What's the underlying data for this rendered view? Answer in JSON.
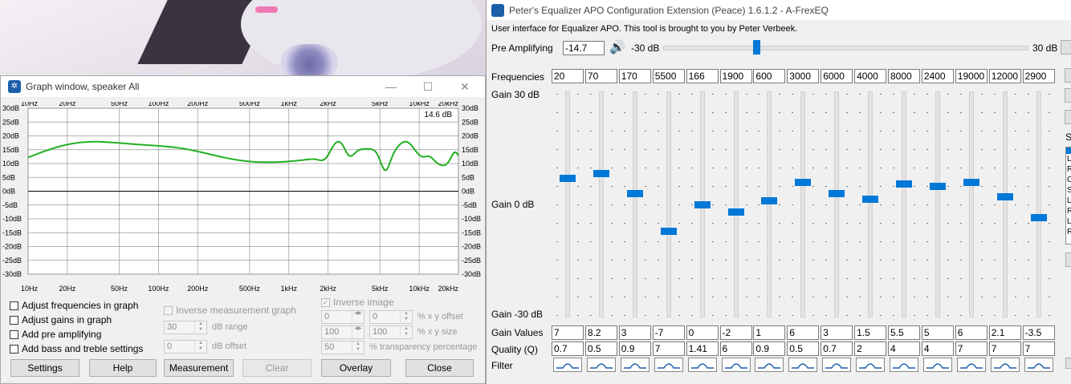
{
  "graph_window": {
    "title": "Graph window, speaker All",
    "readout": "14.6 dB",
    "freq_labels": [
      "10Hz",
      "20Hz",
      "50Hz",
      "100Hz",
      "200Hz",
      "500Hz",
      "1kHz",
      "2kHz",
      "5kHz",
      "10kHz",
      "20kHz"
    ],
    "db_labels": [
      "30dB",
      "25dB",
      "20dB",
      "15dB",
      "10dB",
      "5dB",
      "0dB",
      "-5dB",
      "-10dB",
      "-15dB",
      "-20dB",
      "-25dB",
      "-30dB"
    ],
    "curve_color": "#22b022",
    "checkboxes": {
      "adjust_freq": "Adjust frequencies in graph",
      "adjust_gains": "Adjust gains in graph",
      "add_pre": "Add pre amplifying",
      "add_bass": "Add bass and treble settings",
      "inverse_measurement": "Inverse measurement graph",
      "inverse_image": "Inverse image"
    },
    "db_range_value": "30",
    "db_range_label": "dB range",
    "db_offset_value": "0",
    "db_offset_label": "dB offset",
    "x_offset_a": "0",
    "x_offset_b": "0",
    "x_offset_label": "% x y offset",
    "size_a": "100",
    "size_b": "100",
    "size_label": "% x y size",
    "transparency_value": "50",
    "transparency_label": "% transparency percentage",
    "buttons": {
      "settings": "Settings",
      "help": "Help",
      "measurement": "Measurement",
      "clear": "Clear",
      "overlay": "Overlay",
      "close": "Close"
    }
  },
  "peace": {
    "title": "Peter's Equalizer APO Configuration Extension (Peace) 1.6.1.2 - A-FrexEQ",
    "subtitle": "User interface for Equalizer APO. This tool is brought to you by Peter Verbeek.",
    "pre_amp_label": "Pre Amplifying",
    "pre_amp_value": "-14.7",
    "pre_amp_min": "-30 dB",
    "pre_amp_max": "30 dB",
    "pre_amp_level_db": -14.7,
    "frequencies_label": "Frequencies",
    "gain_top": "Gain 30 dB",
    "gain_mid": "Gain 0 dB",
    "gain_bottom": "Gain -30 dB",
    "gain_values_label": "Gain Values",
    "quality_label": "Quality (Q)",
    "filter_label": "Filter",
    "accent": "#0078d7",
    "bands": [
      {
        "freq": "20",
        "gain": "7",
        "q": "0.7"
      },
      {
        "freq": "70",
        "gain": "8.2",
        "q": "0.5"
      },
      {
        "freq": "170",
        "gain": "3",
        "q": "0.9"
      },
      {
        "freq": "5500",
        "gain": "-7",
        "q": "7"
      },
      {
        "freq": "166",
        "gain": "0",
        "q": "1.41"
      },
      {
        "freq": "1900",
        "gain": "-2",
        "q": "6"
      },
      {
        "freq": "600",
        "gain": "1",
        "q": "0.9"
      },
      {
        "freq": "3000",
        "gain": "6",
        "q": "0.5"
      },
      {
        "freq": "6000",
        "gain": "3",
        "q": "0.7"
      },
      {
        "freq": "4000",
        "gain": "1.5",
        "q": "2"
      },
      {
        "freq": "8000",
        "gain": "5.5",
        "q": "4"
      },
      {
        "freq": "2400",
        "gain": "5",
        "q": "4"
      },
      {
        "freq": "19000",
        "gain": "6",
        "q": "7"
      },
      {
        "freq": "12000",
        "gain": "2.1",
        "q": "7"
      },
      {
        "freq": "2900",
        "gain": "-3.5",
        "q": "7"
      }
    ],
    "side_label_partial": "S",
    "list_partial": [
      "L",
      "R",
      "C",
      "S",
      "L",
      "R",
      "L",
      "R"
    ]
  }
}
